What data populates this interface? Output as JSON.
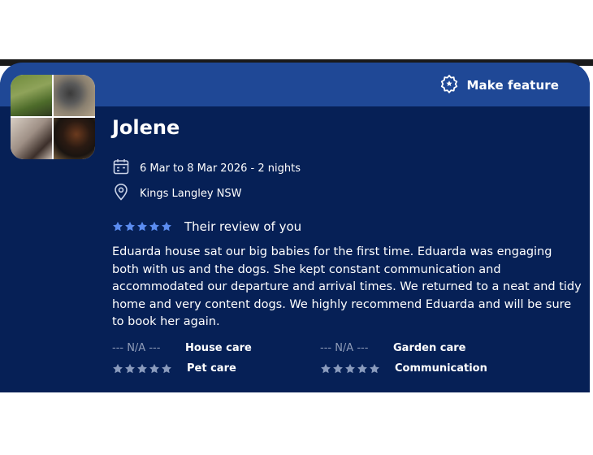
{
  "header": {
    "feature_label": "Make feature"
  },
  "sitter": {
    "name": "Jolene"
  },
  "stay": {
    "dates": "6 Mar to 8 Mar 2026 - 2 nights",
    "location": "Kings Langley NSW"
  },
  "review": {
    "stars": 5,
    "title": "Their review of you",
    "text": "Eduarda house sat our big babies for the first time. Eduarda was engaging both with us and the dogs. She kept constant communication and accommodated our departure and arrival times. We returned to a neat and tidy home and very content dogs. We highly recommend Eduarda and will be sure to book her again."
  },
  "ratings": [
    {
      "label": "House care",
      "value": "--- N/A ---"
    },
    {
      "label": "Garden care",
      "value": "--- N/A ---"
    },
    {
      "label": "Pet care",
      "stars": 5
    },
    {
      "label": "Communication",
      "stars": 5
    }
  ],
  "colors": {
    "card_bg": "#062056",
    "header_bg": "#1f4896",
    "star_active": "#5b8cf0",
    "star_muted": "#8a9bbd"
  }
}
